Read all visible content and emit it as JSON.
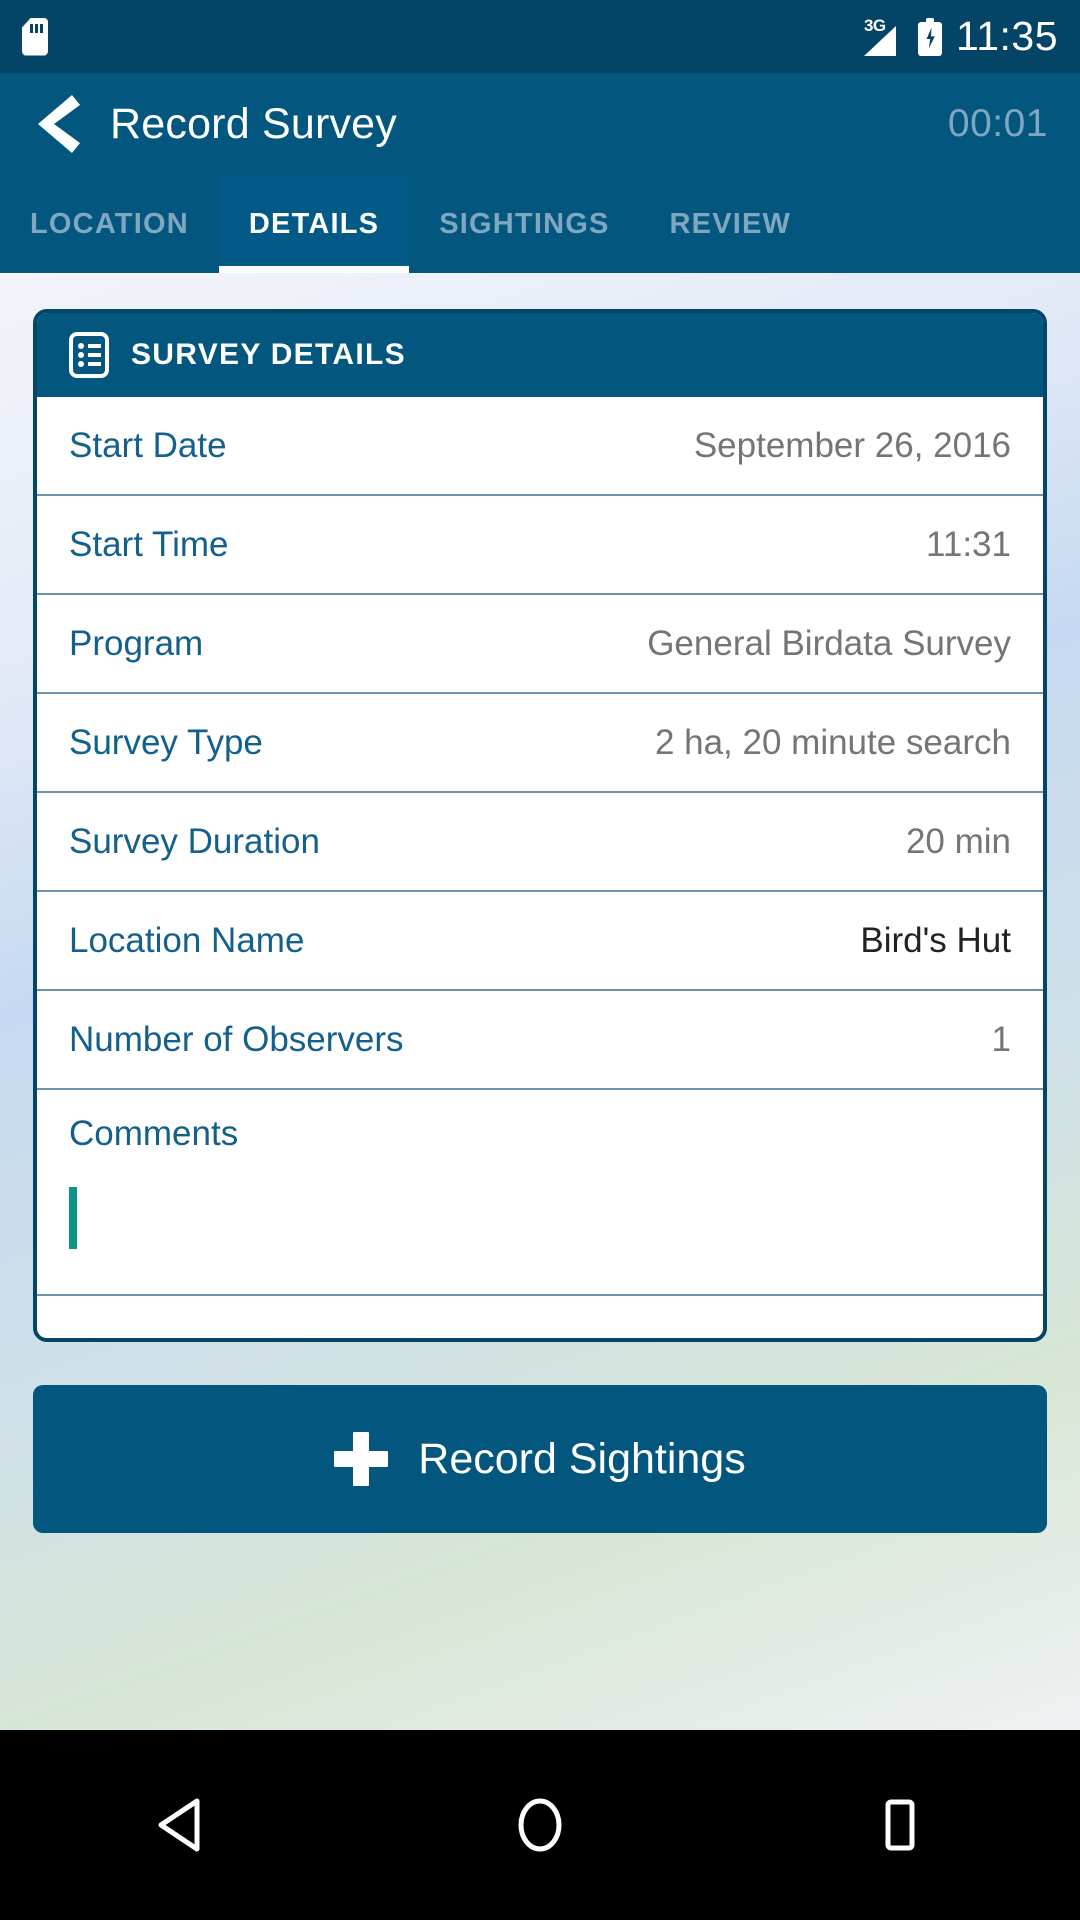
{
  "status_bar": {
    "sd_card_icon": "sd-card-icon",
    "network_label": "3G",
    "signal_icon": "signal-bars-icon",
    "battery_icon": "battery-charging-icon",
    "time": "11:35"
  },
  "app_bar": {
    "back_icon": "back-chevron-icon",
    "title": "Record Survey",
    "timer": "00:01"
  },
  "tabs": [
    {
      "label": "LOCATION",
      "active": false
    },
    {
      "label": "DETAILS",
      "active": true
    },
    {
      "label": "SIGHTINGS",
      "active": false
    },
    {
      "label": "REVIEW",
      "active": false
    }
  ],
  "card": {
    "header_icon": "form-list-icon",
    "header_title": "SURVEY DETAILS",
    "rows": [
      {
        "label": "Start Date",
        "value": "September 26, 2016"
      },
      {
        "label": "Start Time",
        "value": "11:31"
      },
      {
        "label": "Program",
        "value": "General Birdata Survey"
      },
      {
        "label": "Survey Type",
        "value": "2 ha, 20 minute search"
      },
      {
        "label": "Survey Duration",
        "value": "20 min"
      },
      {
        "label": "Location Name",
        "value": "Bird's Hut"
      },
      {
        "label": "Number of Observers",
        "value": "1"
      }
    ],
    "comments": {
      "label": "Comments",
      "value": "",
      "placeholder": ""
    }
  },
  "primary_button": {
    "icon": "plus-icon",
    "label": "Record Sightings"
  },
  "nav_bar": {
    "back_icon": "nav-back-triangle-icon",
    "home_icon": "nav-home-circle-icon",
    "recents_icon": "nav-recents-square-icon"
  },
  "colors": {
    "brand_dark": "#034467",
    "brand": "#03577f",
    "label_blue": "#14608c",
    "value_gray": "#757575",
    "caret_teal": "#0d9488",
    "tab_inactive": "#7fa7c0"
  }
}
